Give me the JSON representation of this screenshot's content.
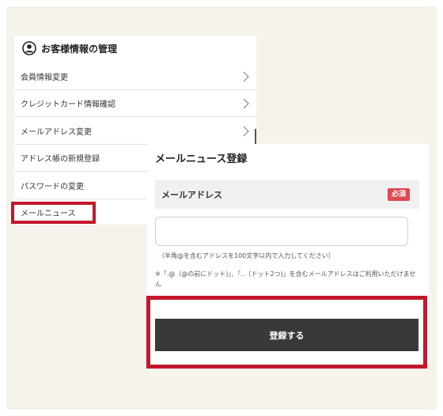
{
  "account": {
    "title": "お客様情報の管理",
    "menu": [
      {
        "label": "会員情報変更",
        "has_chevron": true
      },
      {
        "label": "クレジットカード情報確認",
        "has_chevron": true
      },
      {
        "label": "メールアドレス変更",
        "has_chevron": true
      },
      {
        "label": "アドレス帳の新規登録",
        "has_chevron": false
      },
      {
        "label": "パスワードの変更",
        "has_chevron": false
      },
      {
        "label": "メールニュース",
        "has_chevron": false,
        "highlighted": true
      }
    ]
  },
  "form": {
    "title": "メールニュース登録",
    "field_label": "メールアドレス",
    "required_badge": "必須",
    "email_value": "",
    "hint": "（半角@を含むアドレスを100文字以内で入力してください）",
    "note": "※「.@（@の前にドット)」、「..（ドット2つ)」を含むメールアドレスはご利用いただけません",
    "submit_label": "登録する"
  },
  "colors": {
    "highlight": "#c4172c",
    "badge": "#e0474f",
    "button": "#3b3938",
    "background": "#f6f3ec"
  },
  "icons": {
    "user": "user-circle-icon",
    "chevron": "chevron-right-icon"
  }
}
